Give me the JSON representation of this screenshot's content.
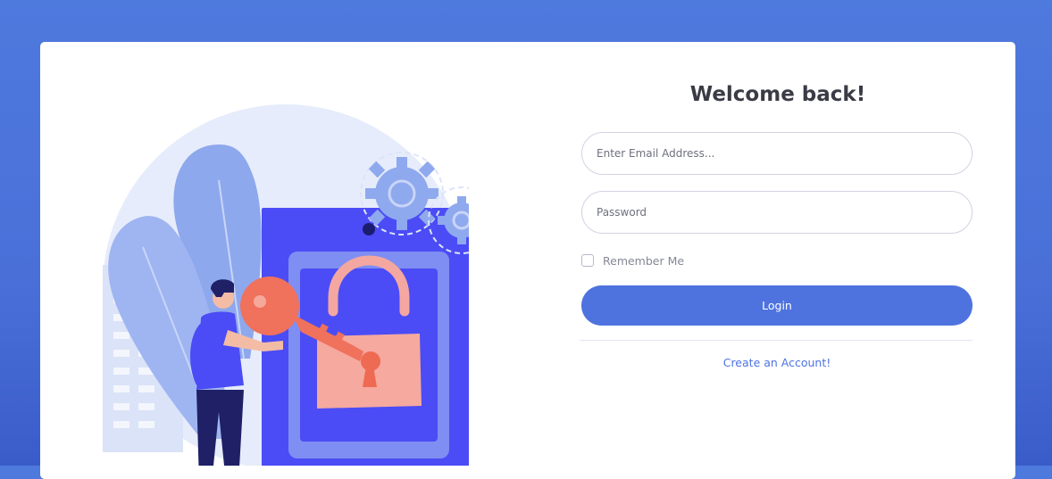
{
  "login": {
    "title": "Welcome back!",
    "email_placeholder": "Enter Email Address...",
    "password_placeholder": "Password",
    "remember_label": "Remember Me",
    "remember_checked": false,
    "login_label": "Login",
    "create_account_label": "Create an Account!"
  },
  "illustration": {
    "icon": "unlock-key-illustration-icon",
    "accent_color": "#4e73df"
  },
  "colors": {
    "background": "#4e73df",
    "card": "#ffffff",
    "primary": "#4e73df",
    "title": "#3a3b45",
    "muted": "#858796",
    "border": "#d1d3e2"
  }
}
